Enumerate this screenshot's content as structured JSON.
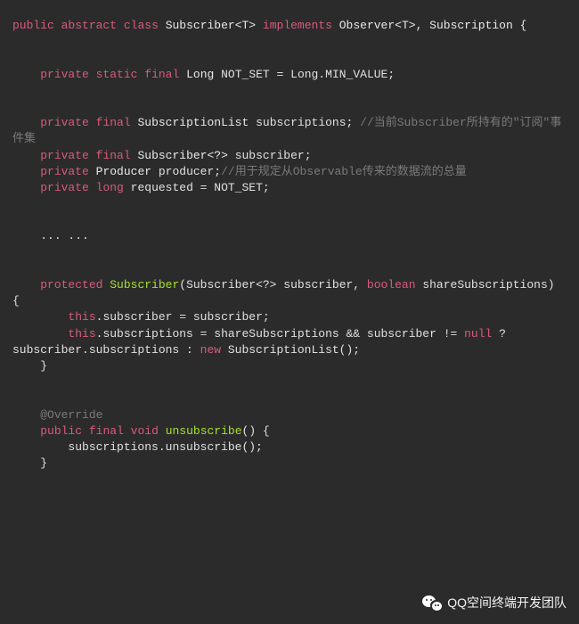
{
  "code": {
    "l1_public": "public",
    "l1_abstract": "abstract",
    "l1_class": "class",
    "l1_name1": "Subscriber<T>",
    "l1_impl": "implements",
    "l1_name2": "Observer<T>, Subscription {",
    "l3_private": "private",
    "l3_static": "static",
    "l3_final": "final",
    "l3_type": "Long",
    "l3_rest": "NOT_SET = Long.MIN_VALUE;",
    "l5_private": "private",
    "l5_final": "final",
    "l5_type": "SubscriptionList",
    "l5_var": "subscriptions;",
    "l5_comment": "//当前Subscriber所持有的\"订阅\"事件集",
    "l6_private": "private",
    "l6_final": "final",
    "l6_type": "Subscriber<?>",
    "l6_var": "subscriber;",
    "l7_private": "private",
    "l7_type": "Producer",
    "l7_var": "producer;",
    "l7_comment": "//用于规定从Observable传来的数据流的总量",
    "l8_private": "private",
    "l8_long": "long",
    "l8_rest": "requested = NOT_SET;",
    "l10_dots": "... ...",
    "l12_protected": "protected",
    "l12_method": "Subscriber",
    "l12_paren_open": "(Subscriber<?> subscriber, ",
    "l12_boolean": "boolean",
    "l12_rest": " shareSubscriptions) {",
    "l13_this": "this",
    "l13_rest": ".subscriber = subscriber;",
    "l14_this": "this",
    "l14_mid": ".subscriptions = shareSubscriptions && subscriber != ",
    "l14_null": "null",
    "l14_mid2": " ? subscriber.subscriptions : ",
    "l14_new": "new",
    "l14_rest": " SubscriptionList();",
    "l15_close": "}",
    "l17_annotation": "@Override",
    "l18_public": "public",
    "l18_final": "final",
    "l18_void": "void",
    "l18_method": "unsubscribe",
    "l18_rest": "() {",
    "l19_body": "subscriptions.unsubscribe();",
    "l20_close": "}"
  },
  "watermark": {
    "icon_name": "wechat-icon",
    "text": "QQ空间终端开发团队"
  }
}
